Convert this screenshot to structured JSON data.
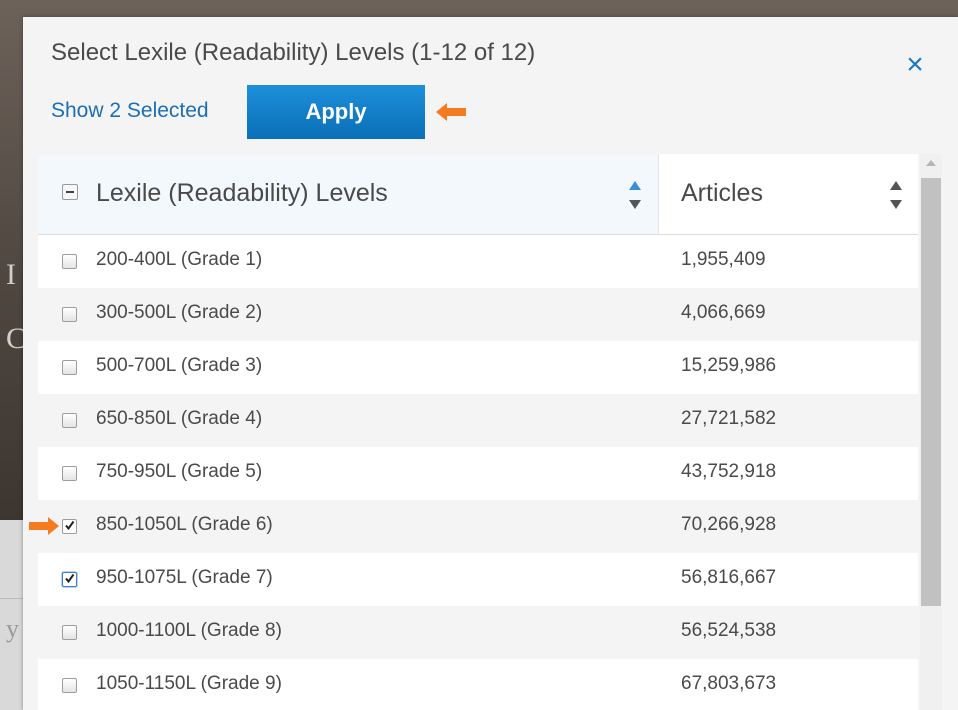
{
  "modal": {
    "title": "Select Lexile (Readability) Levels (1-12 of 12)",
    "close_icon": "×",
    "show_selected_label": "Show 2 Selected",
    "apply_label": "Apply"
  },
  "table": {
    "columns": {
      "levels": "Lexile (Readability) Levels",
      "articles": "Articles"
    },
    "rows": [
      {
        "label": "200-400L (Grade 1)",
        "count": "1,955,409",
        "checked": false
      },
      {
        "label": "300-500L (Grade 2)",
        "count": "4,066,669",
        "checked": false
      },
      {
        "label": "500-700L (Grade 3)",
        "count": "15,259,986",
        "checked": false
      },
      {
        "label": "650-850L (Grade 4)",
        "count": "27,721,582",
        "checked": false
      },
      {
        "label": "750-950L (Grade 5)",
        "count": "43,752,918",
        "checked": false
      },
      {
        "label": "850-1050L (Grade 6)",
        "count": "70,266,928",
        "checked": true
      },
      {
        "label": "950-1075L (Grade 7)",
        "count": "56,816,667",
        "checked": true
      },
      {
        "label": "1000-1100L (Grade 8)",
        "count": "56,524,538",
        "checked": false
      },
      {
        "label": "1050-1150L (Grade 9)",
        "count": "67,803,673",
        "checked": false
      }
    ]
  },
  "background": {
    "glyph_1": "I",
    "glyph_2": "C",
    "glyph_3": "y"
  },
  "colors": {
    "accent": "#1c6fb5",
    "apply_button": "#0a7ac4",
    "annotation_arrow": "#f47b20"
  },
  "icons": {
    "close": "close-icon",
    "sort": "sort-arrows-icon",
    "annotation": "orange-arrow-icon"
  }
}
